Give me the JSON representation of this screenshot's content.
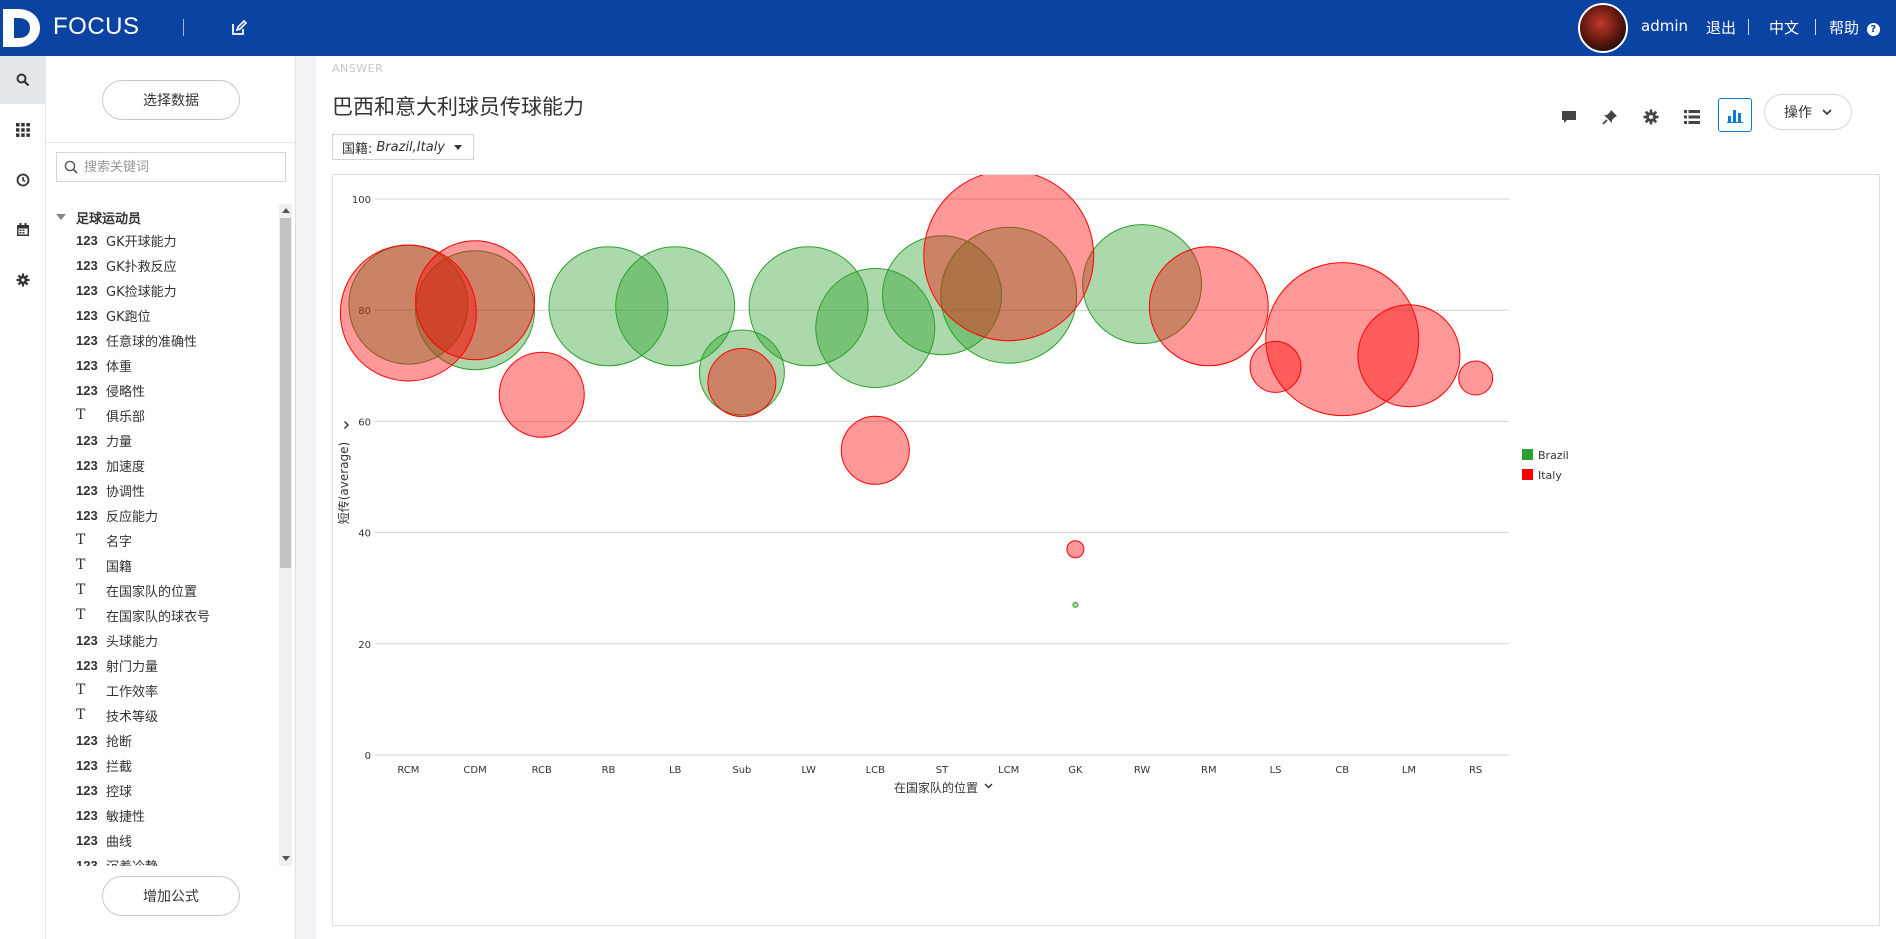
{
  "app": {
    "brand": "FOCUS"
  },
  "topbar": {
    "user": "admin",
    "logout": "退出",
    "language": "中文",
    "help": "帮助"
  },
  "iconbar": [
    {
      "name": "search-icon",
      "active": true
    },
    {
      "name": "apps-grid-icon",
      "active": false
    },
    {
      "name": "history-icon",
      "active": false
    },
    {
      "name": "calendar-icon",
      "active": false
    },
    {
      "name": "settings-icon",
      "active": false
    }
  ],
  "sidebar": {
    "select_data_label": "选择数据",
    "search_placeholder": "搜索关键词",
    "tree_title": "足球运动员",
    "add_formula_label": "增加公式",
    "fields": [
      {
        "type": "123",
        "name": "GK开球能力"
      },
      {
        "type": "123",
        "name": "GK扑救反应"
      },
      {
        "type": "123",
        "name": "GK捡球能力"
      },
      {
        "type": "123",
        "name": "GK跑位"
      },
      {
        "type": "123",
        "name": "任意球的准确性"
      },
      {
        "type": "123",
        "name": "体重"
      },
      {
        "type": "123",
        "name": "侵略性"
      },
      {
        "type": "T",
        "name": "俱乐部"
      },
      {
        "type": "123",
        "name": "力量"
      },
      {
        "type": "123",
        "name": "加速度"
      },
      {
        "type": "123",
        "name": "协调性"
      },
      {
        "type": "123",
        "name": "反应能力"
      },
      {
        "type": "T",
        "name": "名字"
      },
      {
        "type": "T",
        "name": "国籍"
      },
      {
        "type": "T",
        "name": "在国家队的位置"
      },
      {
        "type": "T",
        "name": "在国家队的球衣号"
      },
      {
        "type": "123",
        "name": "头球能力"
      },
      {
        "type": "123",
        "name": "射门力量"
      },
      {
        "type": "T",
        "name": "工作效率"
      },
      {
        "type": "T",
        "name": "技术等级"
      },
      {
        "type": "123",
        "name": "抢断"
      },
      {
        "type": "123",
        "name": "拦截"
      },
      {
        "type": "123",
        "name": "控球"
      },
      {
        "type": "123",
        "name": "敏捷性"
      },
      {
        "type": "123",
        "name": "曲线"
      },
      {
        "type": "123",
        "name": "沉着冷静"
      }
    ]
  },
  "answer": {
    "tag": "ANSWER",
    "title": "巴西和意大利球员传球能力",
    "operations_label": "操作",
    "filter_label": "国籍:",
    "filter_value": "Brazil,Italy"
  },
  "chart_data": {
    "type": "scatter",
    "title": "",
    "xlabel": "在国家队的位置",
    "ylabel": "短传(average)",
    "ylim": [
      0,
      100
    ],
    "yticks": [
      0,
      20,
      40,
      60,
      80,
      100
    ],
    "categories": [
      "RCM",
      "CDM",
      "RCB",
      "RB",
      "LB",
      "Sub",
      "LW",
      "LCB",
      "ST",
      "LCM",
      "GK",
      "RW",
      "RM",
      "LS",
      "CB",
      "LM",
      "RS"
    ],
    "legend_position": "right",
    "grid": true,
    "series": [
      {
        "name": "Brazil",
        "color": "#2ca02c",
        "points": [
          {
            "x": "RCM",
            "y": 81,
            "size": 7
          },
          {
            "x": "CDM",
            "y": 80,
            "size": 7
          },
          {
            "x": "RB",
            "y": 80.7,
            "size": 7
          },
          {
            "x": "LB",
            "y": 80.7,
            "size": 7
          },
          {
            "x": "Sub",
            "y": 68.8,
            "size": 5
          },
          {
            "x": "LW",
            "y": 80.7,
            "size": 7
          },
          {
            "x": "LCB",
            "y": 76.8,
            "size": 7
          },
          {
            "x": "ST",
            "y": 82.7,
            "size": 7
          },
          {
            "x": "LCM",
            "y": 82.7,
            "size": 8
          },
          {
            "x": "GK",
            "y": 27,
            "size": 0.3
          },
          {
            "x": "RW",
            "y": 84.7,
            "size": 7
          }
        ]
      },
      {
        "name": "Italy",
        "color": "#ff0000",
        "points": [
          {
            "x": "RCM",
            "y": 79.5,
            "size": 8
          },
          {
            "x": "CDM",
            "y": 81.8,
            "size": 7
          },
          {
            "x": "RCB",
            "y": 64.8,
            "size": 5
          },
          {
            "x": "Sub",
            "y": 67,
            "size": 4
          },
          {
            "x": "LCB",
            "y": 54.8,
            "size": 4
          },
          {
            "x": "LCM",
            "y": 89.8,
            "size": 10
          },
          {
            "x": "GK",
            "y": 37,
            "size": 1
          },
          {
            "x": "RM",
            "y": 80.7,
            "size": 7
          },
          {
            "x": "LS",
            "y": 69.8,
            "size": 3
          },
          {
            "x": "CB",
            "y": 74.8,
            "size": 9
          },
          {
            "x": "LM",
            "y": 71.8,
            "size": 6
          },
          {
            "x": "RS",
            "y": 67.8,
            "size": 2
          }
        ]
      }
    ]
  }
}
